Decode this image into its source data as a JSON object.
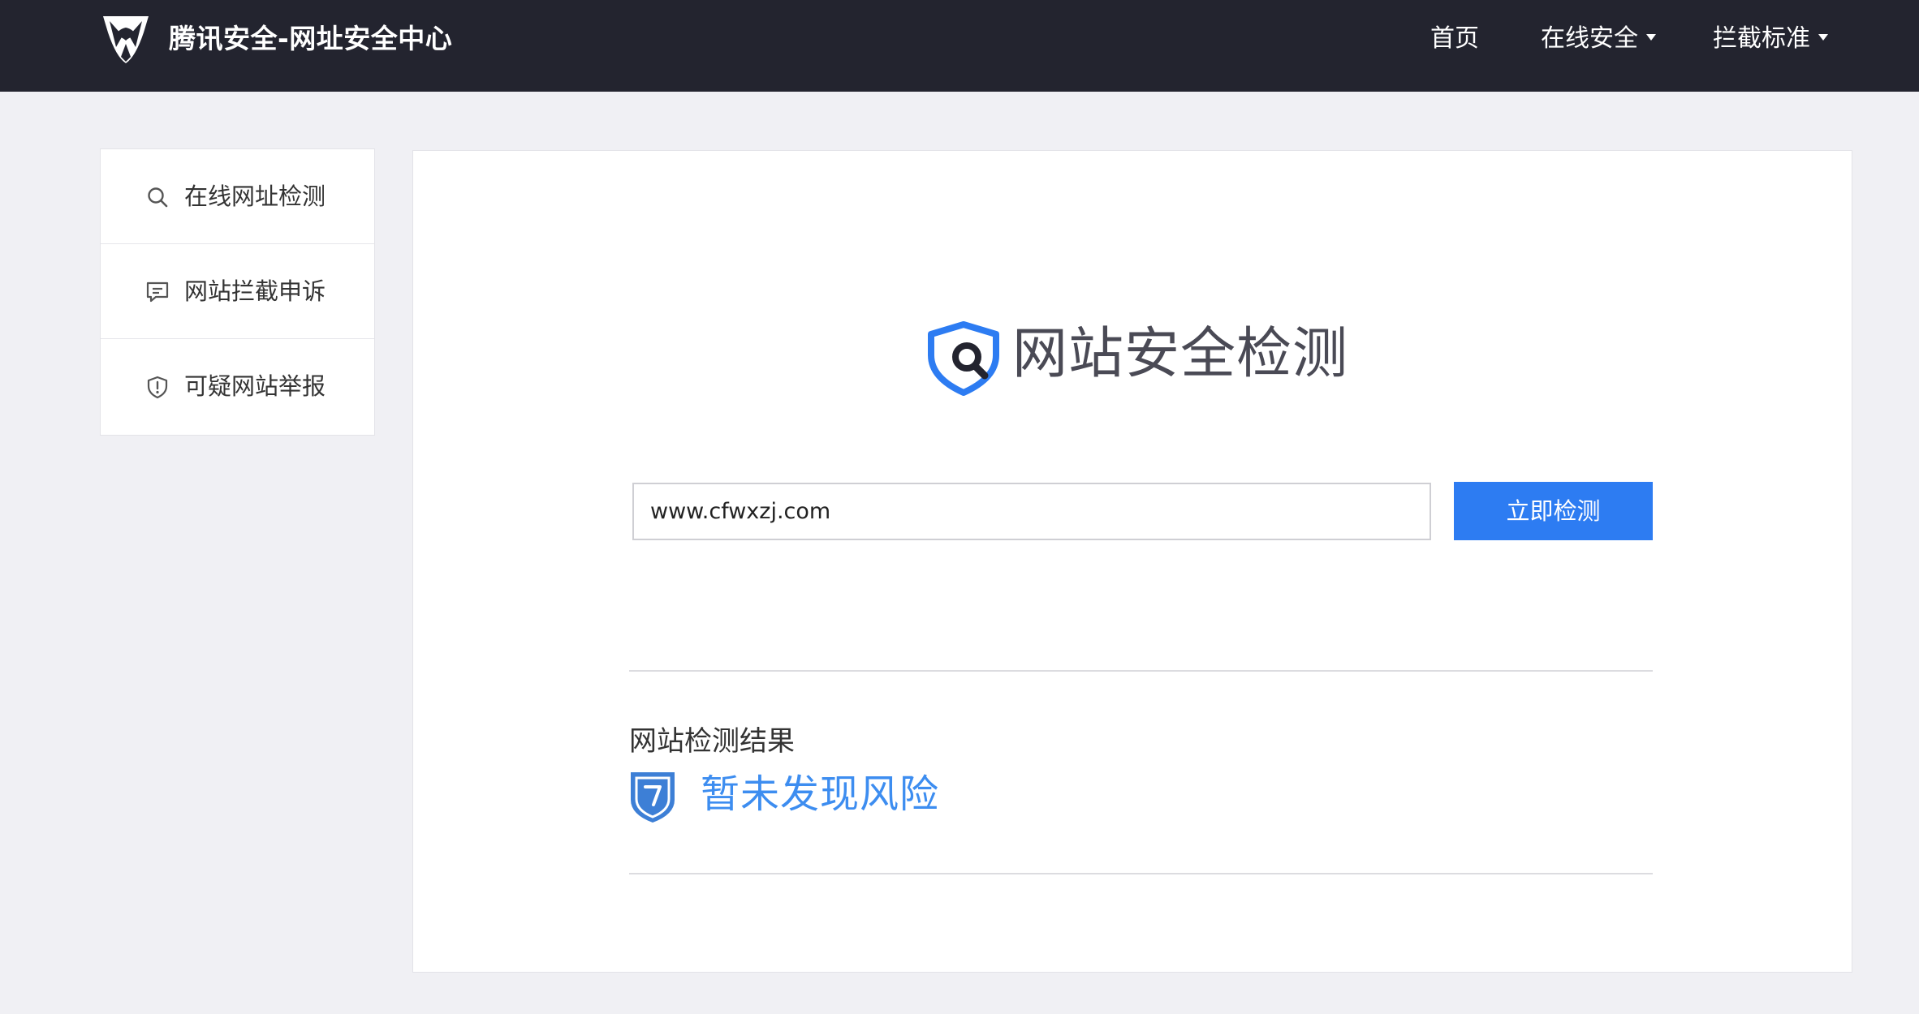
{
  "header": {
    "site_title": "腾讯安全-网址安全中心",
    "nav": {
      "home": "首页",
      "online_security": "在线安全",
      "block_standard": "拦截标准"
    }
  },
  "sidebar": {
    "items": [
      {
        "label": "在线网址检测",
        "icon": "search-icon"
      },
      {
        "label": "网站拦截申诉",
        "icon": "chat-icon"
      },
      {
        "label": "可疑网站举报",
        "icon": "shield-alert-icon"
      }
    ]
  },
  "main": {
    "hero_title": "网站安全检测",
    "url_input_value": "www.cfwxzj.com",
    "scan_button_label": "立即检测",
    "result_heading": "网站检测结果",
    "result_text": "暂未发现风险"
  },
  "colors": {
    "header_bg": "#23242f",
    "accent_blue": "#2d7cf2",
    "result_blue": "#3d8df0",
    "page_bg": "#f0f0f4"
  }
}
